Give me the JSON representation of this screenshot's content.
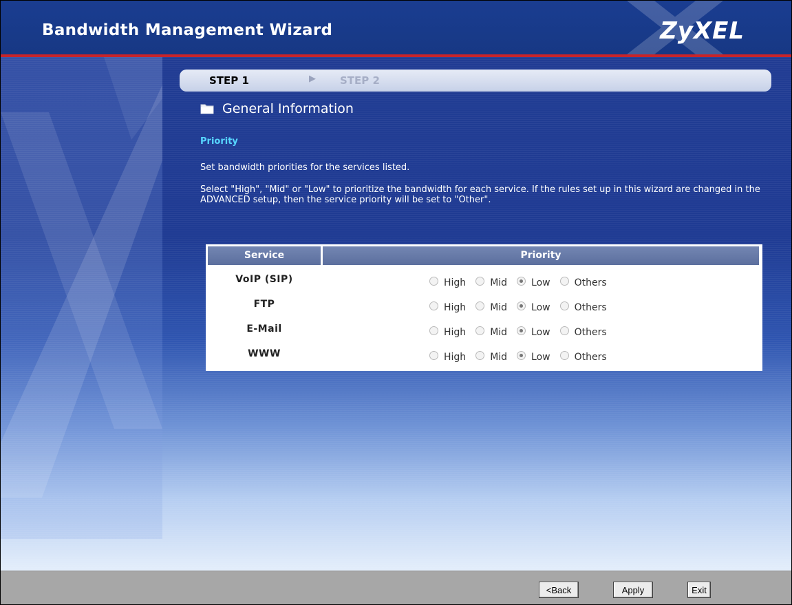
{
  "header": {
    "title": "Bandwidth Management Wizard",
    "logo": "ZyXEL"
  },
  "steps": {
    "step1": "STEP 1",
    "step2": "STEP 2",
    "active": "STEP 1"
  },
  "section": {
    "title": "General Information",
    "icon": "folder-icon"
  },
  "subtitle": "Priority",
  "description": {
    "line1": "Set bandwidth priorities for the services listed.",
    "line2": "Select \"High\", \"Mid\" or \"Low\" to prioritize the bandwidth for each service. If the rules set up in this wizard are changed in the ADVANCED setup, then the service priority will be set to \"Other\"."
  },
  "table": {
    "headers": {
      "service": "Service",
      "priority": "Priority"
    },
    "options": [
      "High",
      "Mid",
      "Low",
      "Others"
    ],
    "rows": [
      {
        "service": "VoIP (SIP)",
        "selected": "Low"
      },
      {
        "service": "FTP",
        "selected": "Low"
      },
      {
        "service": "E-Mail",
        "selected": "Low"
      },
      {
        "service": "WWW",
        "selected": "Low"
      }
    ]
  },
  "buttons": {
    "back": "<Back",
    "apply": "Apply",
    "exit": "Exit"
  },
  "colors": {
    "header_blue": "#1a3d91",
    "accent_red": "#c8242a",
    "subtitle_cyan": "#57d6ff",
    "footer_gray": "#a7a7a7"
  }
}
